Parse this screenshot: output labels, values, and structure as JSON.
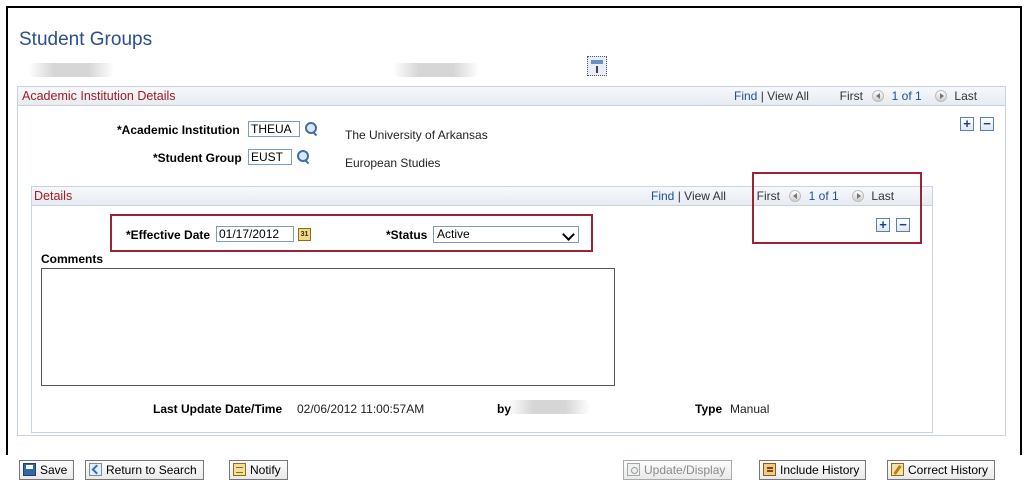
{
  "page": {
    "title": "Student Groups"
  },
  "academic_institution_details": {
    "title": "Academic Institution Details",
    "find": "Find",
    "separator": "|",
    "view_all": "View All",
    "first": "First",
    "count": "1 of 1",
    "last": "Last",
    "academic_institution": {
      "label": "*Academic Institution",
      "value": "THEUA",
      "description": "The University of Arkansas"
    },
    "student_group": {
      "label": "*Student Group",
      "value": "EUST",
      "description": "European Studies"
    },
    "add_label": "+",
    "delete_label": "−"
  },
  "details": {
    "title": "Details",
    "find": "Find",
    "separator": "|",
    "view_all": "View All",
    "first": "First",
    "count": "1 of 1",
    "last": "Last",
    "effective_date": {
      "label": "*Effective Date",
      "value": "01/17/2012",
      "calendar_text": "31"
    },
    "status": {
      "label": "*Status",
      "value": "Active"
    },
    "comments": {
      "label": "Comments",
      "value": ""
    },
    "last_update": {
      "label": "Last Update Date/Time",
      "value": "02/06/2012 11:00:57AM",
      "by_label": "by"
    },
    "type": {
      "label": "Type",
      "value": "Manual"
    },
    "add_label": "+",
    "delete_label": "−"
  },
  "toolbar": {
    "save": "Save",
    "return_to_search": "Return to Search",
    "notify": "Notify",
    "update_display": "Update/Display",
    "include_history": "Include History",
    "correct_history": "Correct History"
  },
  "colors": {
    "title_blue": "#2a4f8a",
    "section_red": "#a11d1d",
    "link_blue": "#1d4f94",
    "highlight": "#9b2335"
  }
}
